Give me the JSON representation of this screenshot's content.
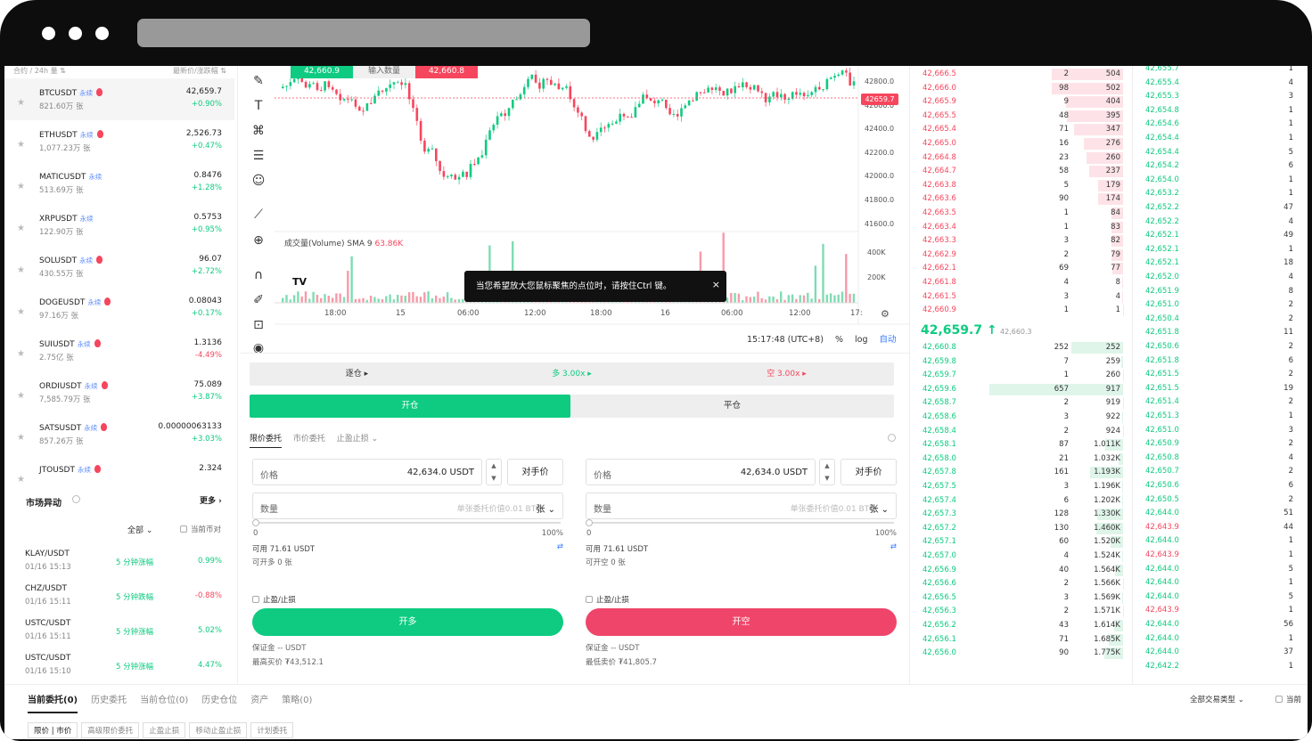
{
  "market_header": {
    "left": "合约 / 24h 量 ⇅",
    "right": "最新价/涨跌幅 ⇅"
  },
  "markets": [
    {
      "symbol": "BTCUSDT",
      "tag": "永续",
      "volume": "821.60万 张",
      "price": "42,659.7",
      "change": "+0.90%",
      "dir": "up",
      "hot": true
    },
    {
      "symbol": "ETHUSDT",
      "tag": "永续",
      "volume": "1,077.23万 张",
      "price": "2,526.73",
      "change": "+0.47%",
      "dir": "up",
      "hot": true
    },
    {
      "symbol": "MATICUSDT",
      "tag": "永续",
      "volume": "513.69万 张",
      "price": "0.8476",
      "change": "+1.28%",
      "dir": "up",
      "hot": false
    },
    {
      "symbol": "XRPUSDT",
      "tag": "永续",
      "volume": "122.90万 张",
      "price": "0.5753",
      "change": "+0.95%",
      "dir": "up",
      "hot": false
    },
    {
      "symbol": "SOLUSDT",
      "tag": "永续",
      "volume": "430.55万 张",
      "price": "96.07",
      "change": "+2.72%",
      "dir": "up",
      "hot": true
    },
    {
      "symbol": "DOGEUSDT",
      "tag": "永续",
      "volume": "97.16万 张",
      "price": "0.08043",
      "change": "+0.17%",
      "dir": "up",
      "hot": true
    },
    {
      "symbol": "SUIUSDT",
      "tag": "永续",
      "volume": "2.75亿 张",
      "price": "1.3136",
      "change": "-4.49%",
      "dir": "down",
      "hot": true
    },
    {
      "symbol": "ORDIUSDT",
      "tag": "永续",
      "volume": "7,585.79万 张",
      "price": "75.089",
      "change": "+3.87%",
      "dir": "up",
      "hot": true
    },
    {
      "symbol": "SATSUSDT",
      "tag": "永续",
      "volume": "857.26万 张",
      "price": "0.00000063133",
      "change": "+3.03%",
      "dir": "up",
      "hot": true
    },
    {
      "symbol": "JTOUSDT",
      "tag": "永续",
      "volume": "",
      "price": "2.324",
      "change": "",
      "dir": "up",
      "hot": true
    }
  ],
  "movers": {
    "title": "市场异动",
    "more": "更多 ›",
    "filter": "全部 ⌄",
    "only_current": "当前币对",
    "rows": [
      {
        "pair": "KLAY/USDT",
        "time": "01/16 15:13",
        "type": "5 分钟涨幅",
        "value": "0.99%",
        "dir": "up"
      },
      {
        "pair": "CHZ/USDT",
        "time": "01/16 15:11",
        "type": "5 分钟跌幅",
        "value": "-0.88%",
        "dir": "down"
      },
      {
        "pair": "USTC/USDT",
        "time": "01/16 15:11",
        "type": "5 分钟涨幅",
        "value": "5.02%",
        "dir": "up"
      },
      {
        "pair": "USTC/USDT",
        "time": "01/16 15:10",
        "type": "5 分钟涨幅",
        "value": "4.47%",
        "dir": "up"
      }
    ]
  },
  "chart": {
    "top_left_value": "42,660.9",
    "top_mid": "输入数量",
    "top_right_value": "42,660.8",
    "y_ticks": [
      "42800.0",
      "42600.0",
      "42400.0",
      "42200.0",
      "42000.0",
      "41800.0",
      "41600.0"
    ],
    "last_price": "42659.7",
    "volume_label": "成交量(Volume) SMA 9",
    "volume_value": "63.86K",
    "vol_ticks": [
      "400K",
      "200K"
    ],
    "x_ticks": [
      "18:00",
      "15",
      "06:00",
      "12:00",
      "18:00",
      "16",
      "06:00",
      "12:00",
      "17:"
    ],
    "tooltip": "当您希望放大您鼠标聚焦的点位时，请按住Ctrl 键。",
    "time": "15:17:48 (UTC+8)",
    "pct": "%",
    "log": "log",
    "auto": "自动",
    "tv_logo": "TV"
  },
  "form": {
    "margin_mode": "逐仓 ▸",
    "long_lev": "多 3.00x ▸",
    "short_lev": "空 3.00x ▸",
    "open": "开仓",
    "close": "平仓",
    "tabs": [
      "限价委托",
      "市价委托",
      "止盈止损 ⌄"
    ],
    "buy": {
      "price_label": "价格",
      "price": "42,634.0  USDT",
      "opp": "对手价",
      "qty_label": "数量",
      "qty_ph": "单张委托价值0.01 BTC",
      "unit": "张 ⌄",
      "min": "0",
      "max": "100%",
      "avail": "可用 71.61 USDT",
      "can": "可开多 0 张",
      "tpsl": "止盈/止损",
      "btn": "开多",
      "margin": "保证金 -- USDT",
      "limit": "最高买价 ₮43,512.1"
    },
    "sell": {
      "price_label": "价格",
      "price": "42,634.0  USDT",
      "opp": "对手价",
      "qty_label": "数量",
      "qty_ph": "单张委托价值0.01 BTC",
      "unit": "张 ⌄",
      "min": "0",
      "max": "100%",
      "avail": "可用 71.61 USDT",
      "can": "可开空 0 张",
      "tpsl": "止盈/止损",
      "btn": "开空",
      "margin": "保证金 -- USDT",
      "limit": "最低卖价 ₮41,805.7"
    }
  },
  "asks": [
    [
      "42,666.5",
      "2",
      "504"
    ],
    [
      "42,666.0",
      "98",
      "502"
    ],
    [
      "42,665.9",
      "9",
      "404"
    ],
    [
      "42,665.5",
      "48",
      "395"
    ],
    [
      "42,665.4",
      "71",
      "347"
    ],
    [
      "42,665.0",
      "16",
      "276"
    ],
    [
      "42,664.8",
      "23",
      "260"
    ],
    [
      "42,664.7",
      "58",
      "237"
    ],
    [
      "42,663.8",
      "5",
      "179"
    ],
    [
      "42,663.6",
      "90",
      "174"
    ],
    [
      "42,663.5",
      "1",
      "84"
    ],
    [
      "42,663.4",
      "1",
      "83"
    ],
    [
      "42,663.3",
      "3",
      "82"
    ],
    [
      "42,662.9",
      "2",
      "79"
    ],
    [
      "42,662.1",
      "69",
      "77"
    ],
    [
      "42,661.8",
      "4",
      "8"
    ],
    [
      "42,661.5",
      "3",
      "4"
    ],
    [
      "42,660.9",
      "1",
      "1"
    ]
  ],
  "mid_price": "42,659.7 ↑",
  "mark_price": "42,660.3",
  "bids": [
    [
      "42,660.8",
      "252",
      "252"
    ],
    [
      "42,659.8",
      "7",
      "259"
    ],
    [
      "42,659.7",
      "1",
      "260"
    ],
    [
      "42,659.6",
      "657",
      "917"
    ],
    [
      "42,658.7",
      "2",
      "919"
    ],
    [
      "42,658.6",
      "3",
      "922"
    ],
    [
      "42,658.4",
      "2",
      "924"
    ],
    [
      "42,658.1",
      "87",
      "1.011K"
    ],
    [
      "42,658.0",
      "21",
      "1.032K"
    ],
    [
      "42,657.8",
      "161",
      "1.193K"
    ],
    [
      "42,657.5",
      "3",
      "1.196K"
    ],
    [
      "42,657.4",
      "6",
      "1.202K"
    ],
    [
      "42,657.3",
      "128",
      "1.330K"
    ],
    [
      "42,657.2",
      "130",
      "1.460K"
    ],
    [
      "42,657.1",
      "60",
      "1.520K"
    ],
    [
      "42,657.0",
      "4",
      "1.524K"
    ],
    [
      "42,656.9",
      "40",
      "1.564K"
    ],
    [
      "42,656.6",
      "2",
      "1.566K"
    ],
    [
      "42,656.5",
      "3",
      "1.569K"
    ],
    [
      "42,656.3",
      "2",
      "1.571K"
    ],
    [
      "42,656.2",
      "43",
      "1.614K"
    ],
    [
      "42,656.1",
      "71",
      "1.685K"
    ],
    [
      "42,656.0",
      "90",
      "1.775K"
    ]
  ],
  "trades": [
    [
      "42,655.7",
      "1",
      "up"
    ],
    [
      "42,655.4",
      "4",
      "up"
    ],
    [
      "42,655.3",
      "3",
      "up"
    ],
    [
      "42,654.8",
      "1",
      "up"
    ],
    [
      "42,654.6",
      "1",
      "up"
    ],
    [
      "42,654.4",
      "1",
      "up"
    ],
    [
      "42,654.4",
      "5",
      "up"
    ],
    [
      "42,654.2",
      "6",
      "up"
    ],
    [
      "42,654.0",
      "1",
      "up"
    ],
    [
      "42,653.2",
      "1",
      "up"
    ],
    [
      "42,652.2",
      "47",
      "up"
    ],
    [
      "42,652.2",
      "4",
      "up"
    ],
    [
      "42,652.1",
      "49",
      "up"
    ],
    [
      "42,652.1",
      "1",
      "up"
    ],
    [
      "42,652.1",
      "18",
      "up"
    ],
    [
      "42,652.0",
      "4",
      "up"
    ],
    [
      "42,651.9",
      "8",
      "up"
    ],
    [
      "42,651.0",
      "2",
      "up"
    ],
    [
      "42,650.4",
      "2",
      "up"
    ],
    [
      "42,651.8",
      "11",
      "up"
    ],
    [
      "42,650.6",
      "2",
      "up"
    ],
    [
      "42,651.8",
      "6",
      "up"
    ],
    [
      "42,651.5",
      "2",
      "up"
    ],
    [
      "42,651.5",
      "19",
      "up"
    ],
    [
      "42,651.4",
      "2",
      "up"
    ],
    [
      "42,651.3",
      "1",
      "up"
    ],
    [
      "42,651.0",
      "3",
      "up"
    ],
    [
      "42,650.9",
      "2",
      "up"
    ],
    [
      "42,650.8",
      "4",
      "up"
    ],
    [
      "42,650.7",
      "2",
      "up"
    ],
    [
      "42,650.6",
      "6",
      "up"
    ],
    [
      "42,650.5",
      "2",
      "up"
    ],
    [
      "42,644.0",
      "51",
      "up"
    ],
    [
      "42,643.9",
      "44",
      "down"
    ],
    [
      "42,644.0",
      "1",
      "up"
    ],
    [
      "42,643.9",
      "1",
      "down"
    ],
    [
      "42,644.0",
      "5",
      "up"
    ],
    [
      "42,644.0",
      "1",
      "up"
    ],
    [
      "42,644.0",
      "5",
      "up"
    ],
    [
      "42,643.9",
      "1",
      "down"
    ],
    [
      "42,644.0",
      "56",
      "up"
    ],
    [
      "42,644.0",
      "1",
      "up"
    ],
    [
      "42,644.0",
      "37",
      "up"
    ],
    [
      "42,642.2",
      "1",
      "up"
    ]
  ],
  "bottom": {
    "tabs": [
      "当前委托(0)",
      "历史委托",
      "当前仓位(0)",
      "历史仓位",
      "资产",
      "策略(0)"
    ],
    "subtabs": [
      "限价 | 市价",
      "高级限价委托",
      "止盈止损",
      "移动止盈止损",
      "计划委托"
    ],
    "right": "全部交易类型 ⌄",
    "right2": "当前"
  }
}
